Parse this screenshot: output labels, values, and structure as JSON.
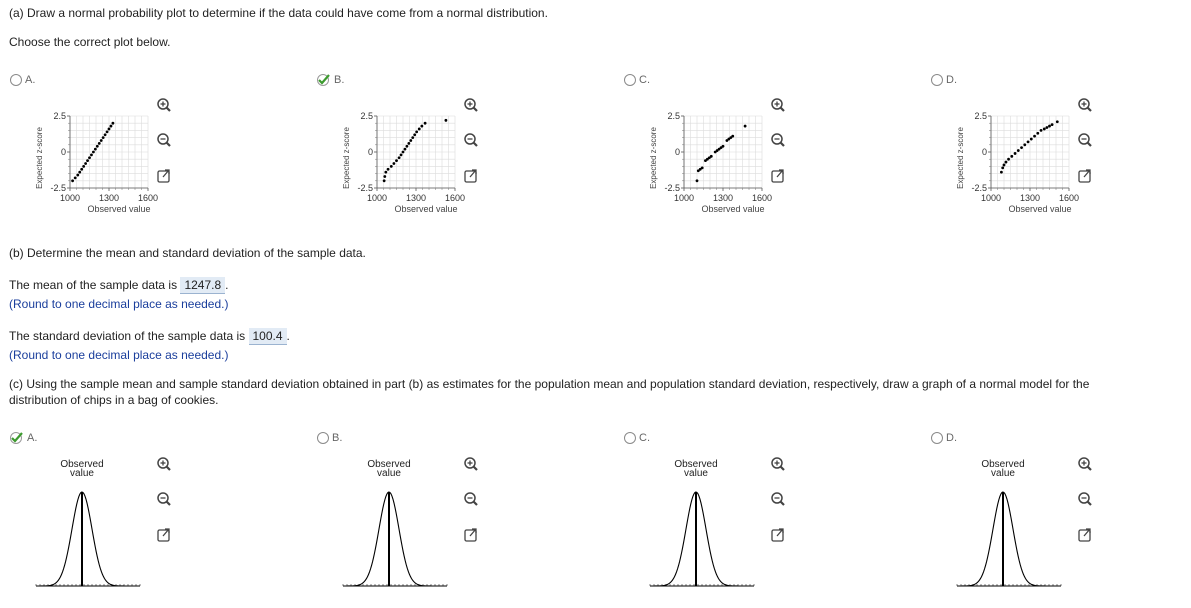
{
  "part_a": {
    "prompt": "(a) Draw a normal probability plot to determine if the data could have come from a normal distribution.",
    "instruction": "Choose the correct plot below.",
    "options": [
      {
        "label": "A.",
        "selected": false
      },
      {
        "label": "B.",
        "selected": true
      },
      {
        "label": "C.",
        "selected": false
      },
      {
        "label": "D.",
        "selected": false
      }
    ]
  },
  "chart_data": [
    {
      "type": "scatter",
      "option": "A",
      "ylabel": "Expected z-score",
      "xlabel": "Observed value",
      "xticks": [
        "1000",
        "1300",
        "1600"
      ],
      "yticks": [
        "2.5",
        "0",
        "-2.5"
      ],
      "xlim": [
        1000,
        1600
      ],
      "ylim": [
        -2.5,
        2.5
      ],
      "x": [
        1020,
        1040,
        1060,
        1075,
        1090,
        1105,
        1120,
        1135,
        1150,
        1165,
        1180,
        1195,
        1210,
        1225,
        1240,
        1255,
        1270,
        1285,
        1300,
        1315,
        1330
      ],
      "y": [
        -2.0,
        -1.8,
        -1.6,
        -1.4,
        -1.2,
        -1.0,
        -0.8,
        -0.6,
        -0.4,
        -0.2,
        0.0,
        0.2,
        0.4,
        0.6,
        0.8,
        1.0,
        1.2,
        1.4,
        1.6,
        1.8,
        2.0
      ]
    },
    {
      "type": "scatter",
      "option": "B",
      "ylabel": "Expected z-score",
      "xlabel": "Observed value",
      "xticks": [
        "1000",
        "1300",
        "1600"
      ],
      "yticks": [
        "2.5",
        "0",
        "-2.5"
      ],
      "xlim": [
        1000,
        1600
      ],
      "ylim": [
        -2.5,
        2.5
      ],
      "x": [
        1055,
        1060,
        1068,
        1085,
        1110,
        1130,
        1150,
        1170,
        1185,
        1200,
        1215,
        1230,
        1245,
        1260,
        1275,
        1290,
        1305,
        1325,
        1345,
        1370,
        1530
      ],
      "y": [
        -2.0,
        -1.7,
        -1.4,
        -1.2,
        -1.0,
        -0.8,
        -0.6,
        -0.4,
        -0.2,
        0.0,
        0.2,
        0.4,
        0.6,
        0.8,
        1.0,
        1.2,
        1.4,
        1.6,
        1.8,
        2.0,
        2.2
      ]
    },
    {
      "type": "scatter",
      "option": "C",
      "ylabel": "Expected z-score",
      "xlabel": "Observed value",
      "xticks": [
        "1000",
        "1300",
        "1600"
      ],
      "yticks": [
        "2.5",
        "0",
        "-2.5"
      ],
      "xlim": [
        1000,
        1600
      ],
      "ylim": [
        -2.5,
        2.5
      ],
      "x": [
        1100,
        1110,
        1125,
        1140,
        1165,
        1180,
        1195,
        1210,
        1240,
        1255,
        1270,
        1285,
        1300,
        1330,
        1345,
        1360,
        1375,
        1470
      ],
      "y": [
        -2.0,
        -1.3,
        -1.2,
        -1.1,
        -0.6,
        -0.5,
        -0.4,
        -0.3,
        0.0,
        0.1,
        0.2,
        0.3,
        0.4,
        0.8,
        0.9,
        1.0,
        1.1,
        1.8
      ]
    },
    {
      "type": "scatter",
      "option": "D",
      "ylabel": "Expected z-score",
      "xlabel": "Observed value",
      "xticks": [
        "1000",
        "1300",
        "1600"
      ],
      "yticks": [
        "2.5",
        "0",
        "-2.5"
      ],
      "xlim": [
        1000,
        1600
      ],
      "ylim": [
        -2.5,
        2.5
      ],
      "x": [
        1080,
        1090,
        1100,
        1115,
        1135,
        1160,
        1185,
        1210,
        1235,
        1260,
        1285,
        1310,
        1335,
        1360,
        1385,
        1410,
        1430,
        1450,
        1470,
        1510
      ],
      "y": [
        -1.4,
        -1.1,
        -0.9,
        -0.7,
        -0.5,
        -0.3,
        -0.1,
        0.1,
        0.3,
        0.5,
        0.7,
        0.9,
        1.1,
        1.3,
        1.5,
        1.6,
        1.7,
        1.8,
        1.9,
        2.1
      ]
    }
  ],
  "part_b": {
    "prompt": "(b) Determine the mean and standard deviation of the sample data.",
    "mean_label": "The mean of the sample data is",
    "mean_value": "1247.8",
    "mean_hint": "(Round to one decimal place as needed.)",
    "sd_label": "The standard deviation of the sample data is",
    "sd_value": "100.4",
    "sd_hint": "(Round to one decimal place as needed.)",
    "period": "."
  },
  "part_c": {
    "prompt_line1": "(c) Using the sample mean and sample standard deviation obtained in part (b) as estimates for the population mean and population standard deviation, respectively, draw a graph of a normal model for the",
    "prompt_line2": "distribution of chips in a bag of cookies.",
    "options": [
      {
        "label": "A.",
        "selected": true,
        "graph_title_line1": "Observed",
        "graph_title_line2": "value"
      },
      {
        "label": "B.",
        "selected": false,
        "graph_title_line1": "Observed",
        "graph_title_line2": "value"
      },
      {
        "label": "C.",
        "selected": false,
        "graph_title_line1": "Observed",
        "graph_title_line2": "value"
      },
      {
        "label": "D.",
        "selected": false,
        "graph_title_line1": "Observed",
        "graph_title_line2": "value"
      }
    ]
  },
  "icons": {
    "zoom_in": "zoom-in-icon",
    "zoom_out": "zoom-out-icon",
    "popout": "popout-icon"
  },
  "colors": {
    "check": "#3c9a2e",
    "text_blue": "#1a3e9c",
    "answer_bg": "#e2ebf5"
  }
}
